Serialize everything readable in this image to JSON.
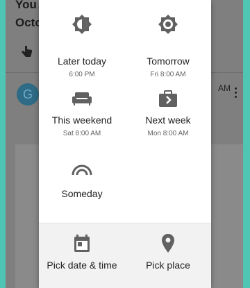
{
  "background": {
    "subject_line_1": "You",
    "subject_line_2": "Octo",
    "avatar_letter": "G",
    "time_fragment": "AM"
  },
  "snooze": {
    "options": [
      {
        "label": "Later today",
        "sub": "6:00 PM",
        "icon": "brightness-half-icon"
      },
      {
        "label": "Tomorrow",
        "sub": "Fri 8:00 AM",
        "icon": "brightness-icon"
      },
      {
        "label": "This weekend",
        "sub": "Sat 8:00 AM",
        "icon": "couch-icon"
      },
      {
        "label": "Next week",
        "sub": "Mon 8:00 AM",
        "icon": "briefcase-icon"
      },
      {
        "label": "Someday",
        "sub": "",
        "icon": "rainbow-icon"
      }
    ],
    "footer": [
      {
        "label": "Pick date & time",
        "icon": "calendar-icon"
      },
      {
        "label": "Pick place",
        "icon": "location-pin-icon"
      }
    ]
  },
  "colors": {
    "accent_teal": "#4fc6b3",
    "icon_gray": "#616161",
    "scrim": "#7f7f7f"
  }
}
